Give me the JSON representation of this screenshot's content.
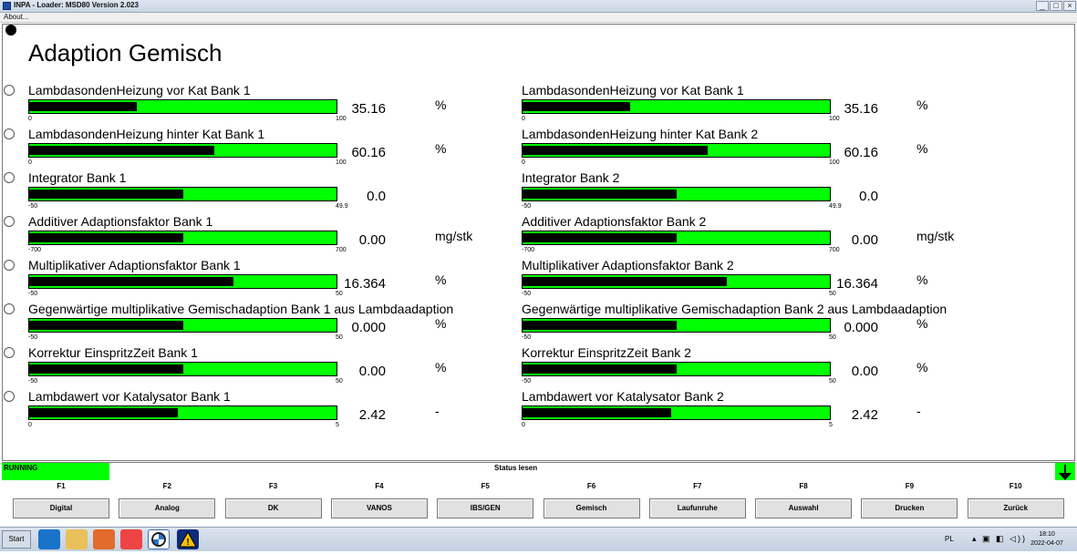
{
  "window": {
    "title": "INPA - Loader:  MSD80 Version 2.023",
    "min": "_",
    "max": "□",
    "close": "×"
  },
  "menu": {
    "about": "About..."
  },
  "page_title": "Adaption Gemisch",
  "rows_left": [
    {
      "label": "LambdasondenHeizung vor Kat Bank 1",
      "value": "35.16",
      "unit": "%",
      "min": "0",
      "max": "100",
      "fraction": 0.3516
    },
    {
      "label": "LambdasondenHeizung hinter Kat Bank 1",
      "value": "60.16",
      "unit": "%",
      "min": "0",
      "max": "100",
      "fraction": 0.6016
    },
    {
      "label": "Integrator Bank 1",
      "value": "0.0",
      "unit": "",
      "min": "-50",
      "max": "49.9",
      "fraction": 0.5
    },
    {
      "label": "Additiver Adaptionsfaktor Bank 1",
      "value": "0.00",
      "unit": "mg/stk",
      "min": "-700",
      "max": "700",
      "fraction": 0.5
    },
    {
      "label": "Multiplikativer Adaptionsfaktor Bank 1",
      "value": "16.364",
      "unit": "%",
      "min": "-50",
      "max": "50",
      "fraction": 0.664
    },
    {
      "label": "Gegenwärtige multiplikative Gemischadaption Bank 1 aus Lambdaadaption",
      "value": "0.000",
      "unit": "%",
      "min": "-50",
      "max": "50",
      "fraction": 0.5
    },
    {
      "label": "Korrektur EinspritzZeit Bank 1",
      "value": "0.00",
      "unit": "%",
      "min": "-50",
      "max": "50",
      "fraction": 0.5
    },
    {
      "label": "Lambdawert vor Katalysator Bank 1",
      "value": "2.42",
      "unit": "-",
      "min": "0",
      "max": "5",
      "fraction": 0.484
    }
  ],
  "rows_right": [
    {
      "label": "LambdasondenHeizung vor Kat Bank 1",
      "value": "35.16",
      "unit": "%",
      "min": "0",
      "max": "100",
      "fraction": 0.3516
    },
    {
      "label": "LambdasondenHeizung hinter Kat Bank 2",
      "value": "60.16",
      "unit": "%",
      "min": "0",
      "max": "100",
      "fraction": 0.6016
    },
    {
      "label": "Integrator Bank 2",
      "value": "0.0",
      "unit": "",
      "min": "-50",
      "max": "49.9",
      "fraction": 0.5
    },
    {
      "label": "Additiver Adaptionsfaktor Bank 2",
      "value": "0.00",
      "unit": "mg/stk",
      "min": "-700",
      "max": "700",
      "fraction": 0.5
    },
    {
      "label": "Multiplikativer Adaptionsfaktor Bank 2",
      "value": "16.364",
      "unit": "%",
      "min": "-50",
      "max": "50",
      "fraction": 0.664
    },
    {
      "label": "Gegenwärtige multiplikative Gemischadaption Bank 2 aus Lambdaadaption",
      "value": "0.000",
      "unit": "%",
      "min": "-50",
      "max": "50",
      "fraction": 0.5
    },
    {
      "label": "Korrektur EinspritzZeit Bank 2",
      "value": "0.00",
      "unit": "%",
      "min": "-50",
      "max": "50",
      "fraction": 0.5
    },
    {
      "label": "Lambdawert vor Katalysator Bank 2",
      "value": "2.42",
      "unit": "-",
      "min": "0",
      "max": "5",
      "fraction": 0.484
    }
  ],
  "status": {
    "running": "RUNNING",
    "center": "Status lesen"
  },
  "fkeys": [
    {
      "key": "F1",
      "label": "Digital"
    },
    {
      "key": "F2",
      "label": "Analog"
    },
    {
      "key": "F3",
      "label": "DK"
    },
    {
      "key": "F4",
      "label": "VANOS"
    },
    {
      "key": "F5",
      "label": "IBS/GEN"
    },
    {
      "key": "F6",
      "label": "Gemisch"
    },
    {
      "key": "F7",
      "label": "Laufunruhe"
    },
    {
      "key": "F8",
      "label": "Auswahl"
    },
    {
      "key": "F9",
      "label": "Drucken"
    },
    {
      "key": "F10",
      "label": "Zurück"
    }
  ],
  "taskbar": {
    "start": "Start",
    "lang": "PL",
    "time": "18:10",
    "date": "2022-04-07"
  },
  "colors": {
    "gauge_bg": "#00ff00",
    "gauge_fill": "#000000",
    "running_bg": "#00ff00"
  }
}
